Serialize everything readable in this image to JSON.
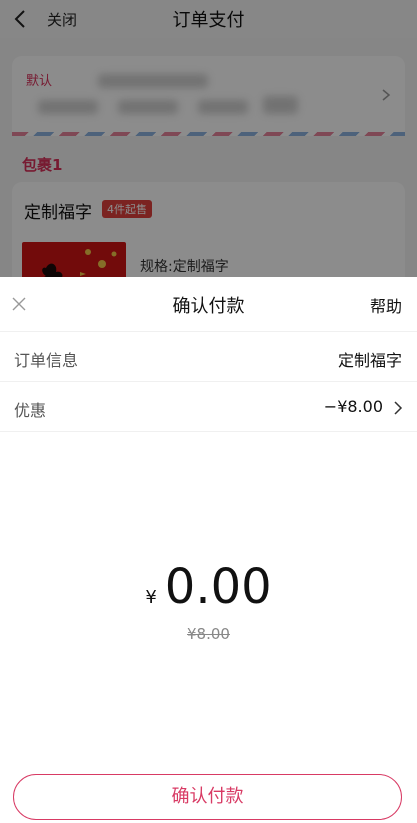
{
  "navbar": {
    "close_label": "关闭",
    "title": "订单支付"
  },
  "address": {
    "default_tag": "默认"
  },
  "package": {
    "label": "包裹1"
  },
  "product": {
    "name": "定制福字",
    "badge": "4件起售",
    "spec": "规格:定制福字"
  },
  "sheet": {
    "title": "确认付款",
    "help": "帮助",
    "order_info_label": "订单信息",
    "order_info_value": "定制福字",
    "discount_label": "优惠",
    "discount_value": "−¥8.00",
    "currency": "¥",
    "amount": "0.00",
    "original_price": "¥8.00",
    "confirm_label": "确认付款"
  },
  "colors": {
    "accent": "#d83a64",
    "badge": "#e0403c"
  },
  "icons": {
    "back": "chevron-left-icon",
    "close": "close-icon",
    "chevron": "chevron-right-icon"
  }
}
